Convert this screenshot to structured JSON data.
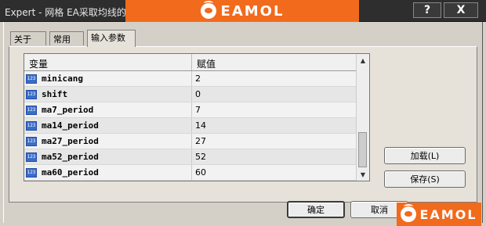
{
  "window": {
    "title": "Expert - 网格 EA采取均线的",
    "watermark_top": "EAMOL",
    "watermark_bottom": "EAMOL",
    "help_glyph": "?",
    "close_glyph": "X",
    "logo_icon": "eamol-logo-icon"
  },
  "tabs": [
    {
      "label": "关于",
      "active": false
    },
    {
      "label": "常用",
      "active": false
    },
    {
      "label": "输入参数",
      "active": true
    }
  ],
  "grid": {
    "columns": [
      "变量",
      "赋值"
    ],
    "type_icon_text": "123",
    "rows": [
      {
        "name": "minicang",
        "value": "2"
      },
      {
        "name": "shift",
        "value": "0"
      },
      {
        "name": "ma7_period",
        "value": "7"
      },
      {
        "name": "ma14_period",
        "value": "14"
      },
      {
        "name": "ma27_period",
        "value": "27"
      },
      {
        "name": "ma52_period",
        "value": "52"
      },
      {
        "name": "ma60_period",
        "value": "60"
      }
    ],
    "scroll_up": "▲",
    "scroll_down": "▼"
  },
  "side_buttons": {
    "load": "加载(L)",
    "save": "保存(S)"
  },
  "bottom_buttons": {
    "ok": "确定",
    "cancel": "取消"
  },
  "colors": {
    "accent": "#f26a1b",
    "titlebar": "#2e2e2e",
    "dialog": "#d4d0c8"
  }
}
